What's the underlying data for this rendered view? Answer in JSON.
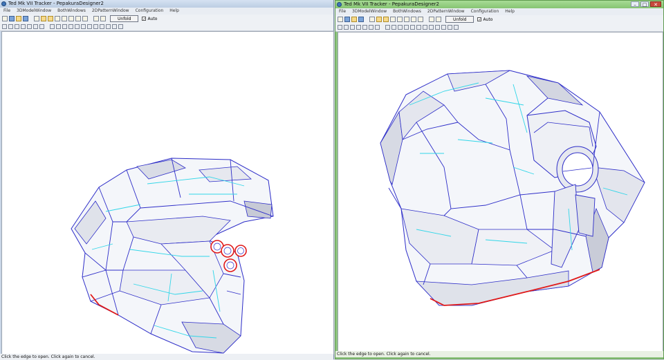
{
  "windows": [
    {
      "title": "Ted Mk VII Tracker - PepakuraDesigner2",
      "menu": [
        "File",
        "3DModelWindow",
        "BothWindows",
        "2DPatternWindow",
        "Configuration",
        "Help"
      ],
      "unfold_label": "Unfold",
      "auto_label": "Auto",
      "auto_checked": true,
      "status": "Click the edge to open. Click again to cancel."
    },
    {
      "title": "Ted Mk VII Tracker - PepakuraDesigner2",
      "menu": [
        "File",
        "3DModelWindow",
        "BothWindows",
        "2DPatternWindow",
        "Configuration",
        "Help"
      ],
      "unfold_label": "Unfold",
      "auto_label": "Auto",
      "auto_checked": true,
      "status": "Click the edge to open. Click again to cancel."
    }
  ],
  "window_controls": {
    "minimize": "–",
    "maximize": "□",
    "close": "✕"
  },
  "icons": {
    "toolbar1": [
      "open-icon",
      "save-icon",
      "paint-icon",
      "texture-icon",
      "cube-icon",
      "select-icon",
      "edit-icon",
      "join-icon",
      "fold-icon",
      "rotate-icon",
      "flip-icon",
      "move-icon",
      "window-icon",
      "window-icon"
    ],
    "toolbar2": [
      "grid-icon",
      "undo-icon",
      "redo-icon",
      "zoom-icon",
      "ruler-icon",
      "cut-icon",
      "glue-icon",
      "flap-icon",
      "mirror-icon",
      "pen-icon",
      "text-icon",
      "image-icon",
      "hide-icon",
      "fit-icon",
      "arrow-left-icon",
      "arrow-right-icon",
      "copy-icon",
      "print-icon",
      "props-icon"
    ]
  },
  "colors": {
    "edge_blue": "#2c2cc8",
    "fold_cyan": "#2fd6e8",
    "open_edge_red": "#e01818",
    "viewport_bg": "#ffffff",
    "left_frame": "#c9d6e6",
    "right_frame": "#8fc47f"
  }
}
